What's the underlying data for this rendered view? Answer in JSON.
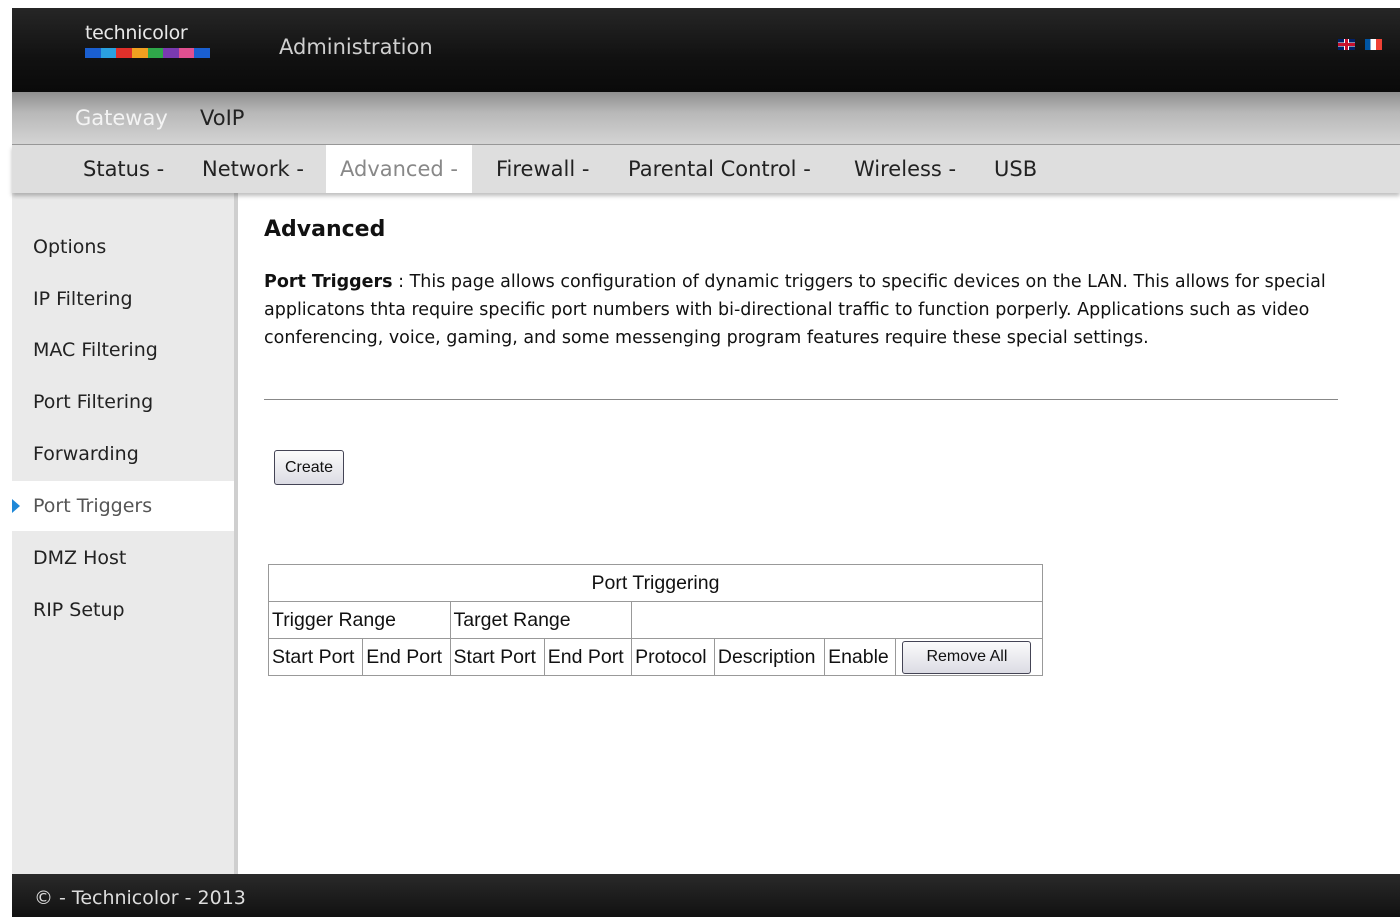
{
  "brand": {
    "logo_text": "technicolor",
    "logo_colors": [
      "#1a5fd0",
      "#2aa0e0",
      "#e0302a",
      "#f0a020",
      "#2fa84a",
      "#7a3ab0",
      "#e05090",
      "#1a5fd0"
    ]
  },
  "header": {
    "title": "Administration",
    "flags": [
      "uk-flag-icon",
      "fr-flag-icon"
    ]
  },
  "topnav": {
    "items": [
      {
        "label": "Gateway",
        "active": true
      },
      {
        "label": "VoIP",
        "active": false
      }
    ]
  },
  "subnav": {
    "items": [
      {
        "label": "Status -"
      },
      {
        "label": "Network -"
      },
      {
        "label": "Advanced -",
        "active": true
      },
      {
        "label": "Firewall -"
      },
      {
        "label": "Parental Control -"
      },
      {
        "label": "Wireless -"
      },
      {
        "label": "USB"
      }
    ]
  },
  "sidebar": {
    "items": [
      {
        "label": "Options"
      },
      {
        "label": "IP Filtering"
      },
      {
        "label": "MAC Filtering"
      },
      {
        "label": "Port Filtering"
      },
      {
        "label": "Forwarding"
      },
      {
        "label": "Port Triggers",
        "active": true
      },
      {
        "label": "DMZ Host"
      },
      {
        "label": "RIP Setup"
      }
    ]
  },
  "main": {
    "title": "Advanced",
    "desc_heading": "Port Triggers",
    "desc_sep": " : ",
    "desc_text": "This page allows configuration of dynamic triggers to specific devices on the LAN. This allows for special applicatons thta require specific port numbers with bi-directional traffic to function porperly. Applications such as video conferencing, voice, gaming, and some messenging program features require these special settings.",
    "create_label": "Create"
  },
  "table": {
    "caption": "Port Triggering",
    "group_headers": [
      "Trigger Range",
      "Target Range"
    ],
    "columns": [
      "Start Port",
      "End Port",
      "Start Port",
      "End Port",
      "Protocol",
      "Description",
      "Enable"
    ],
    "remove_all_label": "Remove All"
  },
  "footer": {
    "text": "© - Technicolor - 2013"
  }
}
